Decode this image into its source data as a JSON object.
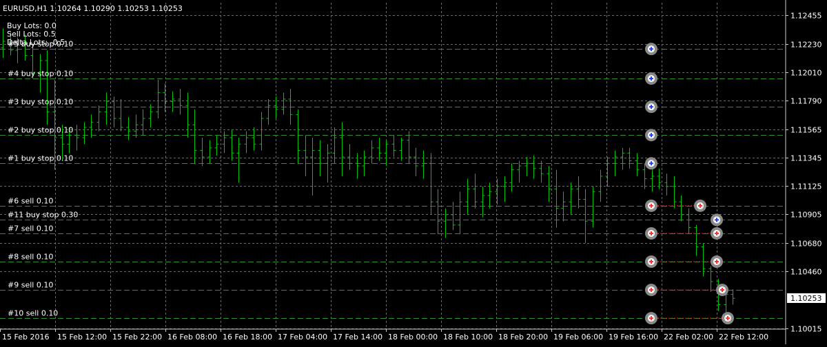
{
  "header": {
    "symbol_line": "EURUSD,H1  1.10264 1.10290 1.10253 1.10253",
    "buy_lots": "Buy Lots: 0.0",
    "sell_lots": "Sell Lots: 0.5",
    "delta_lots": "Delta Lots: -0.5"
  },
  "colors": {
    "background": "#000000",
    "grid": "#6b6b6b",
    "candle": "#00c800",
    "order_line": "#2f8f2f",
    "sell_link": "#e02020",
    "axis_text": "#ffffff",
    "price_box_bg": "#ffffff",
    "price_box_text": "#000000",
    "buy_arrow": "#2040ff",
    "sell_arrow": "#ff3030",
    "marker_ring": "#8a8a8a"
  },
  "chart_data": {
    "type": "ohlc-bars",
    "symbol": "EURUSD",
    "timeframe": "H1",
    "y_ticks": [
      "1.12455",
      "1.12230",
      "1.12010",
      "1.11790",
      "1.11565",
      "1.11345",
      "1.11125",
      "1.10905",
      "1.10680",
      "1.10460",
      "1.10015"
    ],
    "y_range": [
      1.1001,
      1.1255
    ],
    "current_price": "1.10253",
    "x_ticks": [
      "15 Feb 2016",
      "15 Feb 12:00",
      "15 Feb 22:00",
      "16 Feb 08:00",
      "16 Feb 18:00",
      "17 Feb 04:00",
      "17 Feb 14:00",
      "18 Feb 00:00",
      "18 Feb 10:00",
      "18 Feb 20:00",
      "19 Feb 06:00",
      "19 Feb 16:00",
      "22 Feb 02:00",
      "22 Feb 12:00"
    ],
    "bars": [
      [
        1.122,
        1.1235,
        1.1212,
        1.1225
      ],
      [
        1.1225,
        1.1232,
        1.1214,
        1.1218
      ],
      [
        1.1218,
        1.1228,
        1.1208,
        1.1222
      ],
      [
        1.1222,
        1.123,
        1.121,
        1.1214
      ],
      [
        1.1214,
        1.1222,
        1.1196,
        1.12
      ],
      [
        1.12,
        1.1215,
        1.1185,
        1.121
      ],
      [
        1.121,
        1.1218,
        1.116,
        1.117
      ],
      [
        1.117,
        1.1195,
        1.1125,
        1.115
      ],
      [
        1.115,
        1.116,
        1.1132,
        1.1145
      ],
      [
        1.1145,
        1.1158,
        1.1138,
        1.1152
      ],
      [
        1.1152,
        1.116,
        1.114,
        1.115
      ],
      [
        1.115,
        1.1162,
        1.1145,
        1.1158
      ],
      [
        1.1158,
        1.1168,
        1.115,
        1.1162
      ],
      [
        1.1162,
        1.1175,
        1.1155,
        1.117
      ],
      [
        1.117,
        1.1185,
        1.116,
        1.1178
      ],
      [
        1.1178,
        1.1182,
        1.1158,
        1.1165
      ],
      [
        1.1165,
        1.118,
        1.1155,
        1.1158
      ],
      [
        1.1158,
        1.1166,
        1.1148,
        1.1155
      ],
      [
        1.1155,
        1.1168,
        1.115,
        1.116
      ],
      [
        1.116,
        1.1172,
        1.1152,
        1.1165
      ],
      [
        1.1165,
        1.1176,
        1.1158,
        1.117
      ],
      [
        1.117,
        1.1195,
        1.1165,
        1.1185
      ],
      [
        1.1185,
        1.1192,
        1.117,
        1.1178
      ],
      [
        1.1178,
        1.1186,
        1.117,
        1.118
      ],
      [
        1.118,
        1.1188,
        1.1168,
        1.1175
      ],
      [
        1.1175,
        1.1185,
        1.115,
        1.116
      ],
      [
        1.116,
        1.1172,
        1.113,
        1.114
      ],
      [
        1.114,
        1.115,
        1.1128,
        1.1135
      ],
      [
        1.1135,
        1.1148,
        1.113,
        1.1142
      ],
      [
        1.1142,
        1.1152,
        1.1136,
        1.1145
      ],
      [
        1.1145,
        1.1155,
        1.1138,
        1.115
      ],
      [
        1.115,
        1.1156,
        1.1132,
        1.1138
      ],
      [
        1.1138,
        1.115,
        1.1115,
        1.1145
      ],
      [
        1.1145,
        1.1155,
        1.1138,
        1.115
      ],
      [
        1.115,
        1.1158,
        1.114,
        1.1145
      ],
      [
        1.1145,
        1.117,
        1.114,
        1.1165
      ],
      [
        1.1165,
        1.118,
        1.116,
        1.1175
      ],
      [
        1.1175,
        1.1182,
        1.1165,
        1.1172
      ],
      [
        1.1172,
        1.1185,
        1.1168,
        1.118
      ],
      [
        1.118,
        1.1188,
        1.116,
        1.1168
      ],
      [
        1.1168,
        1.1172,
        1.113,
        1.114
      ],
      [
        1.114,
        1.1152,
        1.112,
        1.1135
      ],
      [
        1.1135,
        1.115,
        1.1105,
        1.114
      ],
      [
        1.114,
        1.1148,
        1.112,
        1.113
      ],
      [
        1.113,
        1.1145,
        1.1115,
        1.1138
      ],
      [
        1.1138,
        1.1158,
        1.113,
        1.115
      ],
      [
        1.115,
        1.1162,
        1.112,
        1.1135
      ],
      [
        1.1135,
        1.1145,
        1.1125,
        1.113
      ],
      [
        1.113,
        1.1138,
        1.1118,
        1.1128
      ],
      [
        1.1128,
        1.114,
        1.112,
        1.1135
      ],
      [
        1.1135,
        1.1148,
        1.113,
        1.1142
      ],
      [
        1.1142,
        1.115,
        1.1132,
        1.1138
      ],
      [
        1.1138,
        1.1148,
        1.1128,
        1.1145
      ],
      [
        1.1145,
        1.1152,
        1.1135,
        1.114
      ],
      [
        1.114,
        1.115,
        1.1132,
        1.1148
      ],
      [
        1.1148,
        1.1155,
        1.113,
        1.1135
      ],
      [
        1.1135,
        1.1142,
        1.112,
        1.1128
      ],
      [
        1.1128,
        1.114,
        1.1118,
        1.113
      ],
      [
        1.113,
        1.1138,
        1.109,
        1.11
      ],
      [
        1.11,
        1.111,
        1.1075,
        1.1085
      ],
      [
        1.1085,
        1.1095,
        1.1072,
        1.109
      ],
      [
        1.109,
        1.11,
        1.1078,
        1.1082
      ],
      [
        1.1082,
        1.1108,
        1.1075,
        1.11
      ],
      [
        1.11,
        1.1118,
        1.109,
        1.111
      ],
      [
        1.111,
        1.1122,
        1.1095,
        1.11
      ],
      [
        1.11,
        1.1112,
        1.1088,
        1.1105
      ],
      [
        1.1105,
        1.1115,
        1.1095,
        1.1108
      ],
      [
        1.1108,
        1.1118,
        1.1098,
        1.1112
      ],
      [
        1.1112,
        1.112,
        1.11,
        1.1115
      ],
      [
        1.1115,
        1.113,
        1.1108,
        1.1125
      ],
      [
        1.1125,
        1.1132,
        1.1115,
        1.1128
      ],
      [
        1.1128,
        1.1135,
        1.112,
        1.113
      ],
      [
        1.113,
        1.1136,
        1.1118,
        1.1126
      ],
      [
        1.1126,
        1.1132,
        1.1115,
        1.1122
      ],
      [
        1.1122,
        1.1128,
        1.11,
        1.111
      ],
      [
        1.111,
        1.1125,
        1.108,
        1.1095
      ],
      [
        1.1095,
        1.1108,
        1.1085,
        1.11
      ],
      [
        1.11,
        1.1115,
        1.109,
        1.111
      ],
      [
        1.111,
        1.112,
        1.1095,
        1.1102
      ],
      [
        1.1102,
        1.111,
        1.1068,
        1.1085
      ],
      [
        1.1085,
        1.1112,
        1.108,
        1.1108
      ],
      [
        1.1108,
        1.1125,
        1.11,
        1.112
      ],
      [
        1.112,
        1.1135,
        1.1112,
        1.113
      ],
      [
        1.113,
        1.114,
        1.112,
        1.1135
      ],
      [
        1.1135,
        1.1142,
        1.1125,
        1.1138
      ],
      [
        1.1138,
        1.1142,
        1.1126,
        1.1132
      ],
      [
        1.1132,
        1.1138,
        1.112,
        1.1125
      ],
      [
        1.1125,
        1.113,
        1.111,
        1.1118
      ],
      [
        1.1118,
        1.1125,
        1.1108,
        1.112
      ],
      [
        1.112,
        1.1126,
        1.111,
        1.1115
      ],
      [
        1.1115,
        1.1122,
        1.1105,
        1.1112
      ],
      [
        1.1112,
        1.112,
        1.1095,
        1.11
      ],
      [
        1.11,
        1.1105,
        1.1085,
        1.109
      ],
      [
        1.109,
        1.1095,
        1.1075,
        1.108
      ],
      [
        1.108,
        1.1082,
        1.1058,
        1.1065
      ],
      [
        1.1065,
        1.1068,
        1.1042,
        1.1048
      ],
      [
        1.1048,
        1.105,
        1.103,
        1.1038
      ],
      [
        1.1038,
        1.104,
        1.1015,
        1.102
      ],
      [
        1.102,
        1.1035,
        1.1012,
        1.1028
      ],
      [
        1.1028,
        1.1032,
        1.102,
        1.1025
      ]
    ],
    "orders": [
      {
        "label": "#5 buy stop 0.10",
        "price": 1.1219,
        "side": "buy"
      },
      {
        "label": "#4 buy stop 0.10",
        "price": 1.1196,
        "side": "buy"
      },
      {
        "label": "#3 buy stop 0.10",
        "price": 1.1174,
        "side": "buy"
      },
      {
        "label": "#2 buy stop 0.10",
        "price": 1.1152,
        "side": "buy"
      },
      {
        "label": "#1 buy stop 0.10",
        "price": 1.113,
        "side": "buy"
      },
      {
        "label": "#6 sell 0.10",
        "price": 1.1097,
        "side": "sell"
      },
      {
        "label": "#11 buy stop 0.30",
        "price": 1.1086,
        "side": "buy"
      },
      {
        "label": "#7 sell 0.10",
        "price": 1.10755,
        "side": "sell"
      },
      {
        "label": "#8 sell 0.10",
        "price": 1.10535,
        "side": "sell"
      },
      {
        "label": "#9 sell 0.10",
        "price": 1.10315,
        "side": "sell"
      },
      {
        "label": "#10 sell 0.10",
        "price": 1.10095,
        "side": "sell"
      }
    ]
  }
}
